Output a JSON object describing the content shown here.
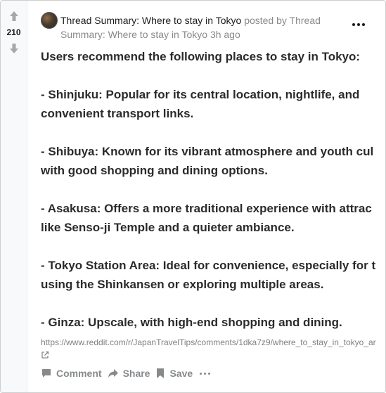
{
  "post": {
    "vote_count": "210",
    "title": "Thread Summary: Where to stay in Tokyo",
    "posted_by_prefix": "posted by",
    "author": "Thread Summary: Where to stay in Tokyo",
    "time_ago": "3h ago",
    "body": [
      "Users recommend the following places to stay in Tokyo:",
      "- Shinjuku: Popular for its central location, nightlife, and",
      "convenient transport links.",
      "- Shibuya: Known for its vibrant atmosphere and youth cul",
      "with good shopping and dining options.",
      "- Asakusa: Offers a more traditional experience with attrac",
      "like Senso-ji Temple and a quieter ambiance.",
      "- Tokyo Station Area: Ideal for convenience, especially for t",
      "using the Shinkansen or exploring multiple areas.",
      "- Ginza: Upscale, with high-end shopping and dining."
    ],
    "link": "https://www.reddit.com/r/JapanTravelTips/comments/1dka7z9/where_to_stay_in_tokyo_ar"
  },
  "actions": {
    "comment": "Comment",
    "share": "Share",
    "save": "Save"
  },
  "icons": {
    "upvote": "arrow-up-icon",
    "downvote": "arrow-down-icon",
    "menu": "more-horizontal-icon",
    "external": "external-link-icon",
    "comment": "comment-icon",
    "share": "share-icon",
    "save": "bookmark-icon"
  },
  "colors": {
    "vote_arrow": "#a5a8aa",
    "meta_text": "#878a8c",
    "body_text": "#2b2b2b"
  }
}
